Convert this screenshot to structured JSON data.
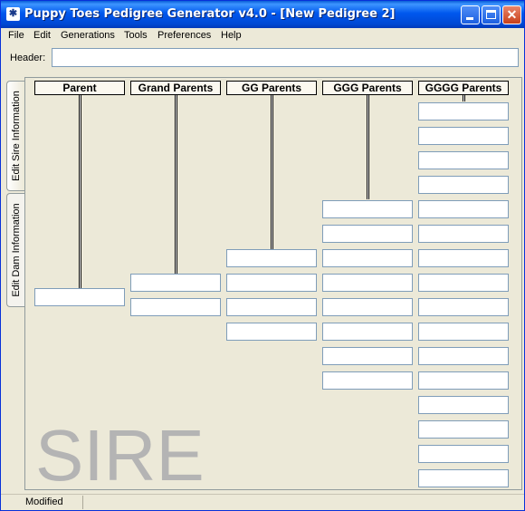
{
  "window": {
    "title": "Puppy Toes Pedigree Generator v4.0 - [New Pedigree 2]"
  },
  "menu": [
    "File",
    "Edit",
    "Generations",
    "Tools",
    "Preferences",
    "Help"
  ],
  "header": {
    "label": "Header:",
    "value": ""
  },
  "tabs": {
    "sire": "Edit Sire Information",
    "dam": "Edit Dam Information"
  },
  "columns": [
    "Parent",
    "Grand Parents",
    "GG Parents",
    "GGG Parents",
    "GGGG Parents"
  ],
  "watermark": "SIRE",
  "status": {
    "text": "Modified"
  }
}
